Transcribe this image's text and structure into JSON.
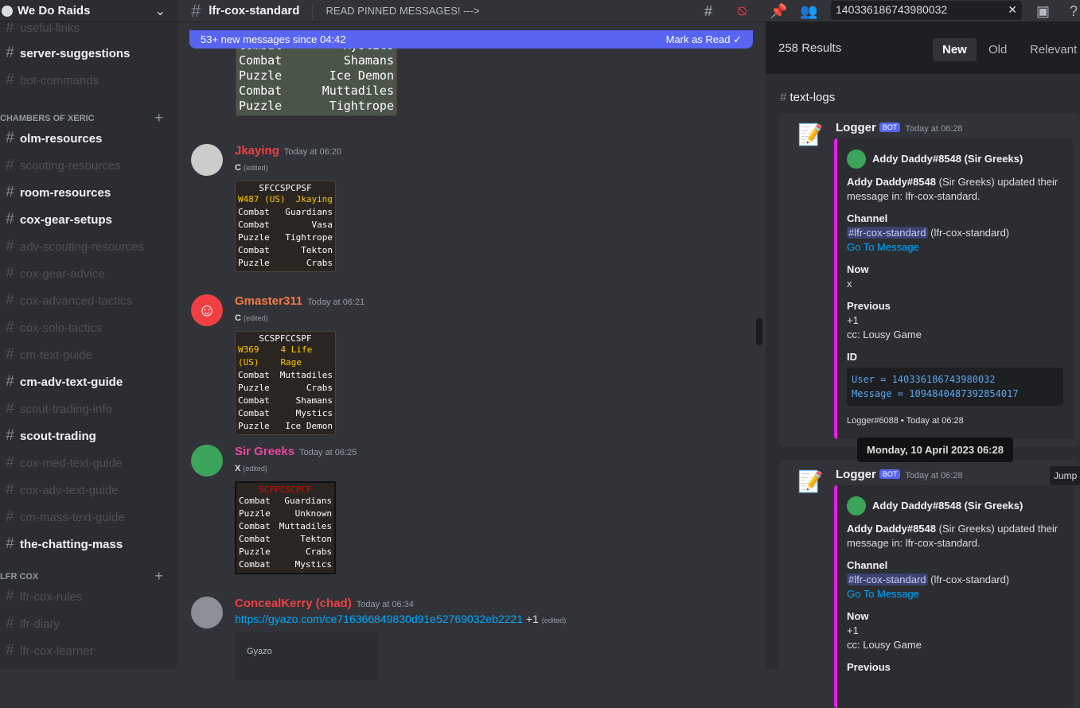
{
  "server": {
    "name": "We Do Raids"
  },
  "sidebar": {
    "top_partial": "useful-links",
    "pre": [
      {
        "label": "server-suggestions",
        "active": true
      },
      {
        "label": "bot-commands",
        "active": false
      }
    ],
    "categories": [
      {
        "label": "CHAMBERS OF XERIC",
        "channels": [
          {
            "label": "olm-resources",
            "active": true
          },
          {
            "label": "scouting-resources",
            "active": false
          },
          {
            "label": "room-resources",
            "active": true
          },
          {
            "label": "cox-gear-setups",
            "active": true
          },
          {
            "label": "adv-scouting-resources",
            "active": false
          },
          {
            "label": "cox-gear-advice",
            "active": false
          },
          {
            "label": "cox-advanced-tactics",
            "active": false
          },
          {
            "label": "cox-solo-tactics",
            "active": false
          },
          {
            "label": "cm-text-guide",
            "active": false
          },
          {
            "label": "cm-adv-text-guide",
            "active": true
          },
          {
            "label": "scout-trading-info",
            "active": false
          },
          {
            "label": "scout-trading",
            "active": true
          },
          {
            "label": "cox-med-text-guide",
            "active": false
          },
          {
            "label": "cox-adv-text-guide",
            "active": false
          },
          {
            "label": "cm-mass-text-guide",
            "active": false
          },
          {
            "label": "the-chatting-mass",
            "active": true
          }
        ]
      },
      {
        "label": "LFR COX",
        "channels": [
          {
            "label": "lfr-cox-rules",
            "active": false
          },
          {
            "label": "lfr-diary",
            "active": false
          },
          {
            "label": "lfr-cox-learner",
            "active": false
          }
        ]
      }
    ]
  },
  "header": {
    "channel": "lfr-cox-standard",
    "topic": "READ PINNED MESSAGES! --->",
    "search_value": "140336186743980032"
  },
  "banner": {
    "text": "53+ new messages since 04:42",
    "action": "Mark as Read"
  },
  "top_image": {
    "rows": [
      [
        "Combat",
        "Mystics"
      ],
      [
        "Combat",
        "Shamans"
      ],
      [
        "Puzzle",
        "Ice Demon"
      ],
      [
        "Combat",
        "Muttadiles"
      ],
      [
        "Puzzle",
        "Tightrope"
      ]
    ]
  },
  "messages": [
    {
      "author": "Jkaying",
      "color": "#f23f43",
      "time": "Today at 06:20",
      "text": "C",
      "edited": "(edited)",
      "image": {
        "title": "SFCCSPCPSF",
        "world": "W487 (US)",
        "host": "Jkaying",
        "rows": [
          [
            "Combat",
            "Guardians"
          ],
          [
            "Combat",
            "Vasa"
          ],
          [
            "Puzzle",
            "Tightrope"
          ],
          [
            "Combat",
            "Tekton"
          ],
          [
            "Puzzle",
            "Crabs"
          ]
        ]
      }
    },
    {
      "author": "Gmaster311",
      "color": "#f47b43",
      "time": "Today at 06:21",
      "text": "C",
      "edited": "(edited)",
      "image": {
        "title": "SCSPFCCSPF",
        "world": "W369 (US)",
        "host": "4 Life Rage",
        "rows": [
          [
            "Combat",
            "Muttadiles"
          ],
          [
            "Puzzle",
            "Crabs"
          ],
          [
            "Combat",
            "Shamans"
          ],
          [
            "Combat",
            "Mystics"
          ],
          [
            "Puzzle",
            "Ice Demon"
          ]
        ]
      }
    },
    {
      "author": "Sir Greeks",
      "color": "#eb459f",
      "time": "Today at 06:25",
      "text": "X",
      "edited": "(edited)",
      "image": {
        "title": "SCFPCSCPCF",
        "rows": [
          [
            "Combat",
            "Guardians"
          ],
          [
            "Puzzle",
            "Unknown"
          ],
          [
            "Combat",
            "Muttadiles"
          ],
          [
            "Combat",
            "Tekton"
          ],
          [
            "Puzzle",
            "Crabs"
          ],
          [
            "Combat",
            "Mystics"
          ]
        ]
      }
    },
    {
      "author": "ConcealKerry (chad)",
      "color": "#f23f43",
      "time": "Today at 06:34",
      "link": "https://gyazo.com/ce716366849830d91e52769032eb2221",
      "after": "+1",
      "edited": "(edited)",
      "embed_site": "Gyazo"
    }
  ],
  "search": {
    "count": "258 Results",
    "sort": [
      "New",
      "Old",
      "Relevant"
    ],
    "channel": "text-logs",
    "results": [
      {
        "author": "Logger",
        "badge": "BOT",
        "time": "Today at 06:28",
        "embed_author": "Addy Daddy#8548 (Sir Greeks)",
        "desc_bold": "Addy Daddy#8548",
        "desc_rest": " (Sir Greeks) updated their message in: lfr-cox-standard.",
        "channel_label": "Channel",
        "mention": "#lfr-cox-standard",
        "mention_after": " (lfr-cox-standard)",
        "goto": "Go To Message",
        "now_label": "Now",
        "now": [
          "x"
        ],
        "prev_label": "Previous",
        "prev": [
          "+1",
          "cc: Lousy Game"
        ],
        "id_label": "ID",
        "code": [
          "User = 140336186743980032",
          "Message = 1094840487392854017"
        ],
        "footer": "Logger#6088 • Today at 06:28"
      },
      {
        "author": "Logger",
        "badge": "BOT",
        "time": "Today at 06:28",
        "embed_author": "Addy Daddy#8548 (Sir Greeks)",
        "desc_bold": "Addy Daddy#8548",
        "desc_rest": " (Sir Greeks) updated their message in: lfr-cox-standard.",
        "channel_label": "Channel",
        "mention": "#lfr-cox-standard",
        "mention_after": " (lfr-cox-standard)",
        "goto": "Go To Message",
        "now_label": "Now",
        "now": [
          "+1",
          "cc: Lousy Game"
        ],
        "prev_label": "Previous"
      }
    ],
    "tooltip": "Monday, 10 April 2023 06:28",
    "jump": "Jump"
  },
  "colors": {
    "accent": "#5865f2",
    "embed_bar": "#e91ee9",
    "link": "#00a8fc"
  }
}
